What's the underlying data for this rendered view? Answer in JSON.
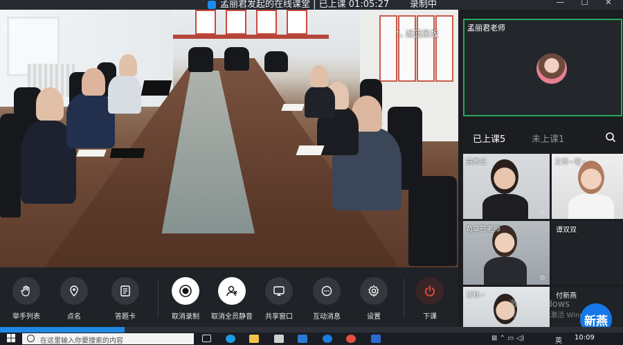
{
  "window": {
    "title": "孟丽君发起的在线课堂 | 已上课 01:05:27",
    "record_status": "录制中",
    "win_controls": "— ☐ ✕"
  },
  "main_video": {
    "watermark": "孟丽君老师",
    "back_to_board": "返回黑板"
  },
  "teacher": {
    "name": "孟丽君老师"
  },
  "tabs": {
    "attended": "已上课5",
    "absent": "未上课1"
  },
  "students": [
    {
      "name": "高秀云"
    },
    {
      "name": "王秀~老~"
    },
    {
      "name": "苟卓芬老师"
    },
    {
      "name": "谭双双"
    },
    {
      "name": "汪秋~"
    },
    {
      "name": "付新燕"
    }
  ],
  "toolbar": {
    "raise_hands": "举手列表",
    "roll_call": "点名",
    "answer_card": "答题卡",
    "cancel_record": "取消录制",
    "unmute_all": "取消全员静音",
    "share_window": "共享窗口",
    "messages": "互动消息",
    "settings": "设置",
    "end_class": "下课"
  },
  "activation": {
    "line1": "激活 Windows",
    "line2": "转到“设置”以激活 Windows。"
  },
  "badge_text": "新燕",
  "taskbar": {
    "search_placeholder": "在这里输入你要搜索的内容",
    "time": "10:09",
    "lang": "英"
  },
  "colors": {
    "accent": "#1e88e5",
    "teacher_border": "#28a85a",
    "end_red": "#f04e3c"
  }
}
